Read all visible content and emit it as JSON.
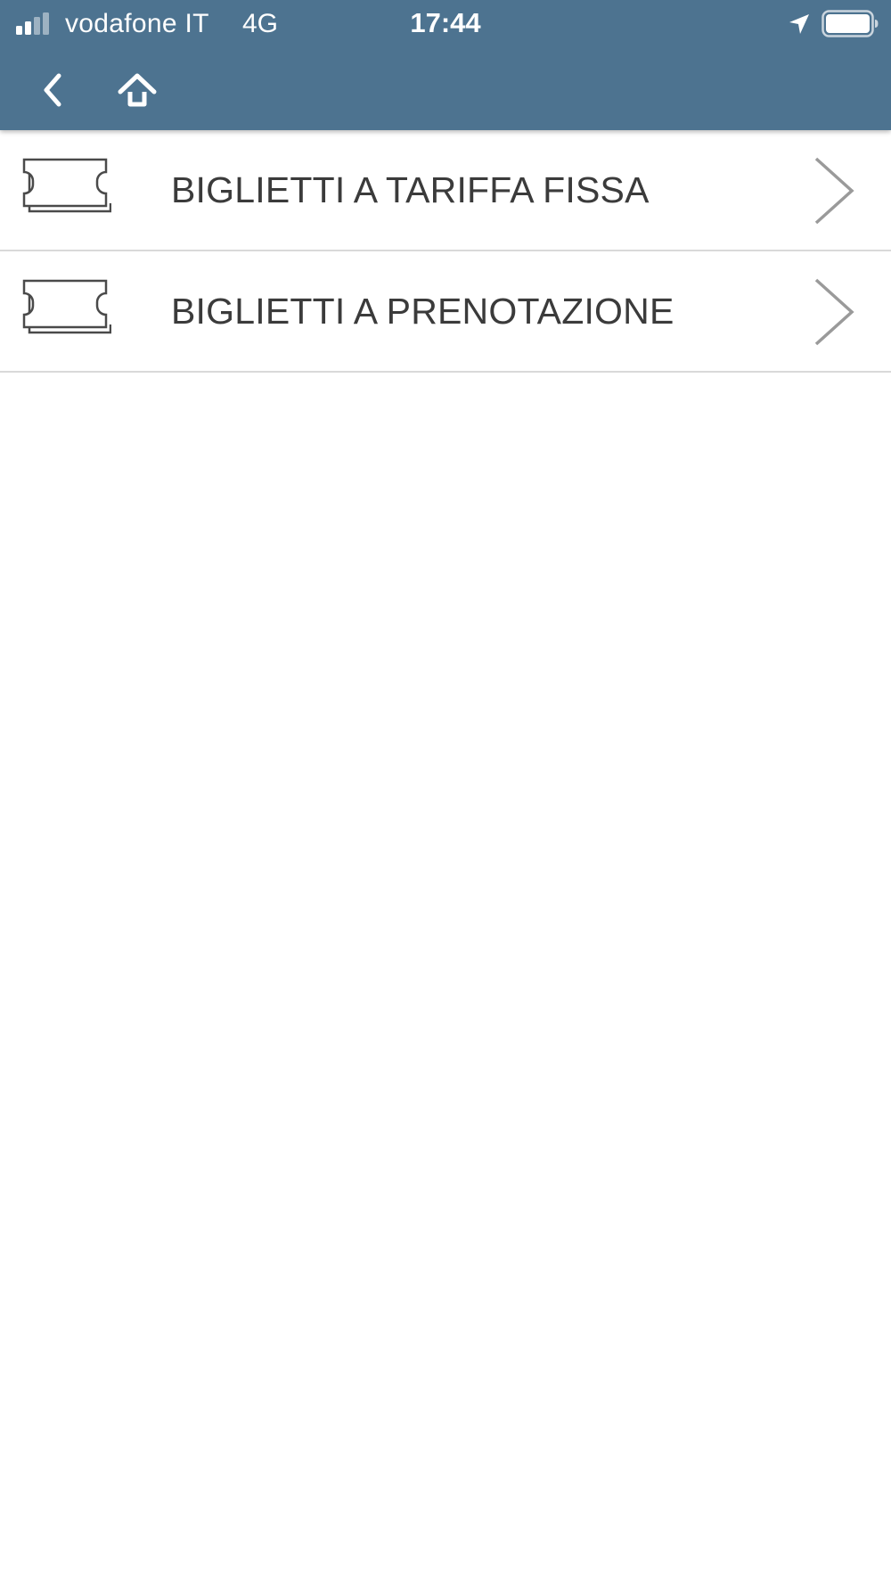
{
  "status_bar": {
    "carrier": "vodafone IT",
    "network": "4G",
    "time": "17:44",
    "signal_icon": "signal-bars-icon",
    "location_icon": "location-arrow-icon",
    "battery_icon": "battery-full-icon"
  },
  "nav_bar": {
    "back_icon": "chevron-left-icon",
    "home_icon": "home-icon"
  },
  "menu": {
    "items": [
      {
        "label": "BIGLIETTI A TARIFFA FISSA",
        "icon": "ticket-icon",
        "trailing_icon": "chevron-right-icon"
      },
      {
        "label": "BIGLIETTI A PRENOTAZIONE",
        "icon": "ticket-icon",
        "trailing_icon": "chevron-right-icon"
      }
    ]
  },
  "colors": {
    "header_background": "#4d7390",
    "text": "#3b3b3b",
    "divider": "#d9d9d9",
    "chevron": "#9a9a9a"
  }
}
